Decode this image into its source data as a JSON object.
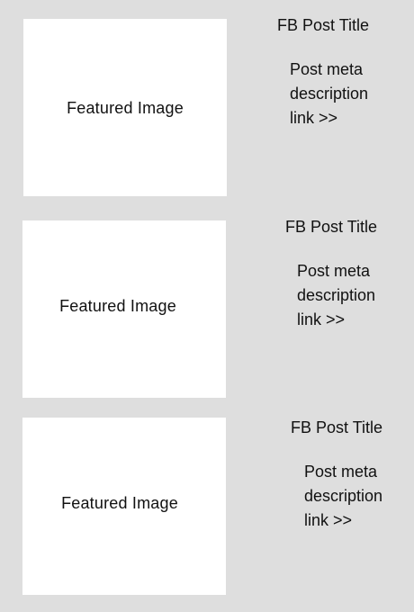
{
  "posts": [
    {
      "image_label": "Featured Image",
      "title": "FB Post Title",
      "meta_lines": [
        "Post meta",
        "description",
        "link >>"
      ]
    },
    {
      "image_label": "Featured Image",
      "title": "FB Post Title",
      "meta_lines": [
        "Post meta",
        "description",
        "link >>"
      ]
    },
    {
      "image_label": "Featured Image",
      "title": "FB Post Title",
      "meta_lines": [
        "Post meta",
        "description",
        "link >>"
      ]
    }
  ]
}
